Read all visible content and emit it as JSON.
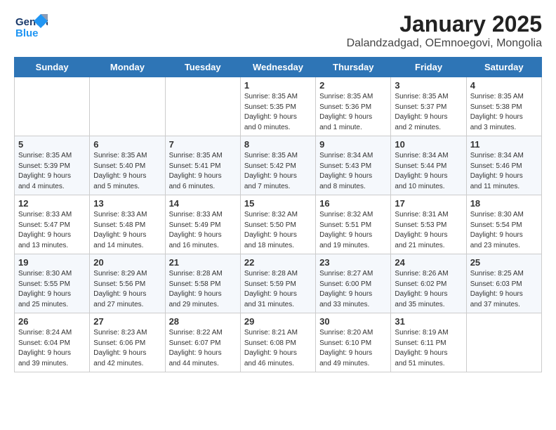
{
  "header": {
    "logo_general": "General",
    "logo_blue": "Blue",
    "main_title": "January 2025",
    "subtitle": "Dalandzadgad, OEmnoegovi, Mongolia"
  },
  "days_of_week": [
    "Sunday",
    "Monday",
    "Tuesday",
    "Wednesday",
    "Thursday",
    "Friday",
    "Saturday"
  ],
  "weeks": [
    [
      {
        "date": "",
        "info": ""
      },
      {
        "date": "",
        "info": ""
      },
      {
        "date": "",
        "info": ""
      },
      {
        "date": "1",
        "info": "Sunrise: 8:35 AM\nSunset: 5:35 PM\nDaylight: 9 hours\nand 0 minutes."
      },
      {
        "date": "2",
        "info": "Sunrise: 8:35 AM\nSunset: 5:36 PM\nDaylight: 9 hours\nand 1 minute."
      },
      {
        "date": "3",
        "info": "Sunrise: 8:35 AM\nSunset: 5:37 PM\nDaylight: 9 hours\nand 2 minutes."
      },
      {
        "date": "4",
        "info": "Sunrise: 8:35 AM\nSunset: 5:38 PM\nDaylight: 9 hours\nand 3 minutes."
      }
    ],
    [
      {
        "date": "5",
        "info": "Sunrise: 8:35 AM\nSunset: 5:39 PM\nDaylight: 9 hours\nand 4 minutes."
      },
      {
        "date": "6",
        "info": "Sunrise: 8:35 AM\nSunset: 5:40 PM\nDaylight: 9 hours\nand 5 minutes."
      },
      {
        "date": "7",
        "info": "Sunrise: 8:35 AM\nSunset: 5:41 PM\nDaylight: 9 hours\nand 6 minutes."
      },
      {
        "date": "8",
        "info": "Sunrise: 8:35 AM\nSunset: 5:42 PM\nDaylight: 9 hours\nand 7 minutes."
      },
      {
        "date": "9",
        "info": "Sunrise: 8:34 AM\nSunset: 5:43 PM\nDaylight: 9 hours\nand 8 minutes."
      },
      {
        "date": "10",
        "info": "Sunrise: 8:34 AM\nSunset: 5:44 PM\nDaylight: 9 hours\nand 10 minutes."
      },
      {
        "date": "11",
        "info": "Sunrise: 8:34 AM\nSunset: 5:46 PM\nDaylight: 9 hours\nand 11 minutes."
      }
    ],
    [
      {
        "date": "12",
        "info": "Sunrise: 8:33 AM\nSunset: 5:47 PM\nDaylight: 9 hours\nand 13 minutes."
      },
      {
        "date": "13",
        "info": "Sunrise: 8:33 AM\nSunset: 5:48 PM\nDaylight: 9 hours\nand 14 minutes."
      },
      {
        "date": "14",
        "info": "Sunrise: 8:33 AM\nSunset: 5:49 PM\nDaylight: 9 hours\nand 16 minutes."
      },
      {
        "date": "15",
        "info": "Sunrise: 8:32 AM\nSunset: 5:50 PM\nDaylight: 9 hours\nand 18 minutes."
      },
      {
        "date": "16",
        "info": "Sunrise: 8:32 AM\nSunset: 5:51 PM\nDaylight: 9 hours\nand 19 minutes."
      },
      {
        "date": "17",
        "info": "Sunrise: 8:31 AM\nSunset: 5:53 PM\nDaylight: 9 hours\nand 21 minutes."
      },
      {
        "date": "18",
        "info": "Sunrise: 8:30 AM\nSunset: 5:54 PM\nDaylight: 9 hours\nand 23 minutes."
      }
    ],
    [
      {
        "date": "19",
        "info": "Sunrise: 8:30 AM\nSunset: 5:55 PM\nDaylight: 9 hours\nand 25 minutes."
      },
      {
        "date": "20",
        "info": "Sunrise: 8:29 AM\nSunset: 5:56 PM\nDaylight: 9 hours\nand 27 minutes."
      },
      {
        "date": "21",
        "info": "Sunrise: 8:28 AM\nSunset: 5:58 PM\nDaylight: 9 hours\nand 29 minutes."
      },
      {
        "date": "22",
        "info": "Sunrise: 8:28 AM\nSunset: 5:59 PM\nDaylight: 9 hours\nand 31 minutes."
      },
      {
        "date": "23",
        "info": "Sunrise: 8:27 AM\nSunset: 6:00 PM\nDaylight: 9 hours\nand 33 minutes."
      },
      {
        "date": "24",
        "info": "Sunrise: 8:26 AM\nSunset: 6:02 PM\nDaylight: 9 hours\nand 35 minutes."
      },
      {
        "date": "25",
        "info": "Sunrise: 8:25 AM\nSunset: 6:03 PM\nDaylight: 9 hours\nand 37 minutes."
      }
    ],
    [
      {
        "date": "26",
        "info": "Sunrise: 8:24 AM\nSunset: 6:04 PM\nDaylight: 9 hours\nand 39 minutes."
      },
      {
        "date": "27",
        "info": "Sunrise: 8:23 AM\nSunset: 6:06 PM\nDaylight: 9 hours\nand 42 minutes."
      },
      {
        "date": "28",
        "info": "Sunrise: 8:22 AM\nSunset: 6:07 PM\nDaylight: 9 hours\nand 44 minutes."
      },
      {
        "date": "29",
        "info": "Sunrise: 8:21 AM\nSunset: 6:08 PM\nDaylight: 9 hours\nand 46 minutes."
      },
      {
        "date": "30",
        "info": "Sunrise: 8:20 AM\nSunset: 6:10 PM\nDaylight: 9 hours\nand 49 minutes."
      },
      {
        "date": "31",
        "info": "Sunrise: 8:19 AM\nSunset: 6:11 PM\nDaylight: 9 hours\nand 51 minutes."
      },
      {
        "date": "",
        "info": ""
      }
    ]
  ]
}
